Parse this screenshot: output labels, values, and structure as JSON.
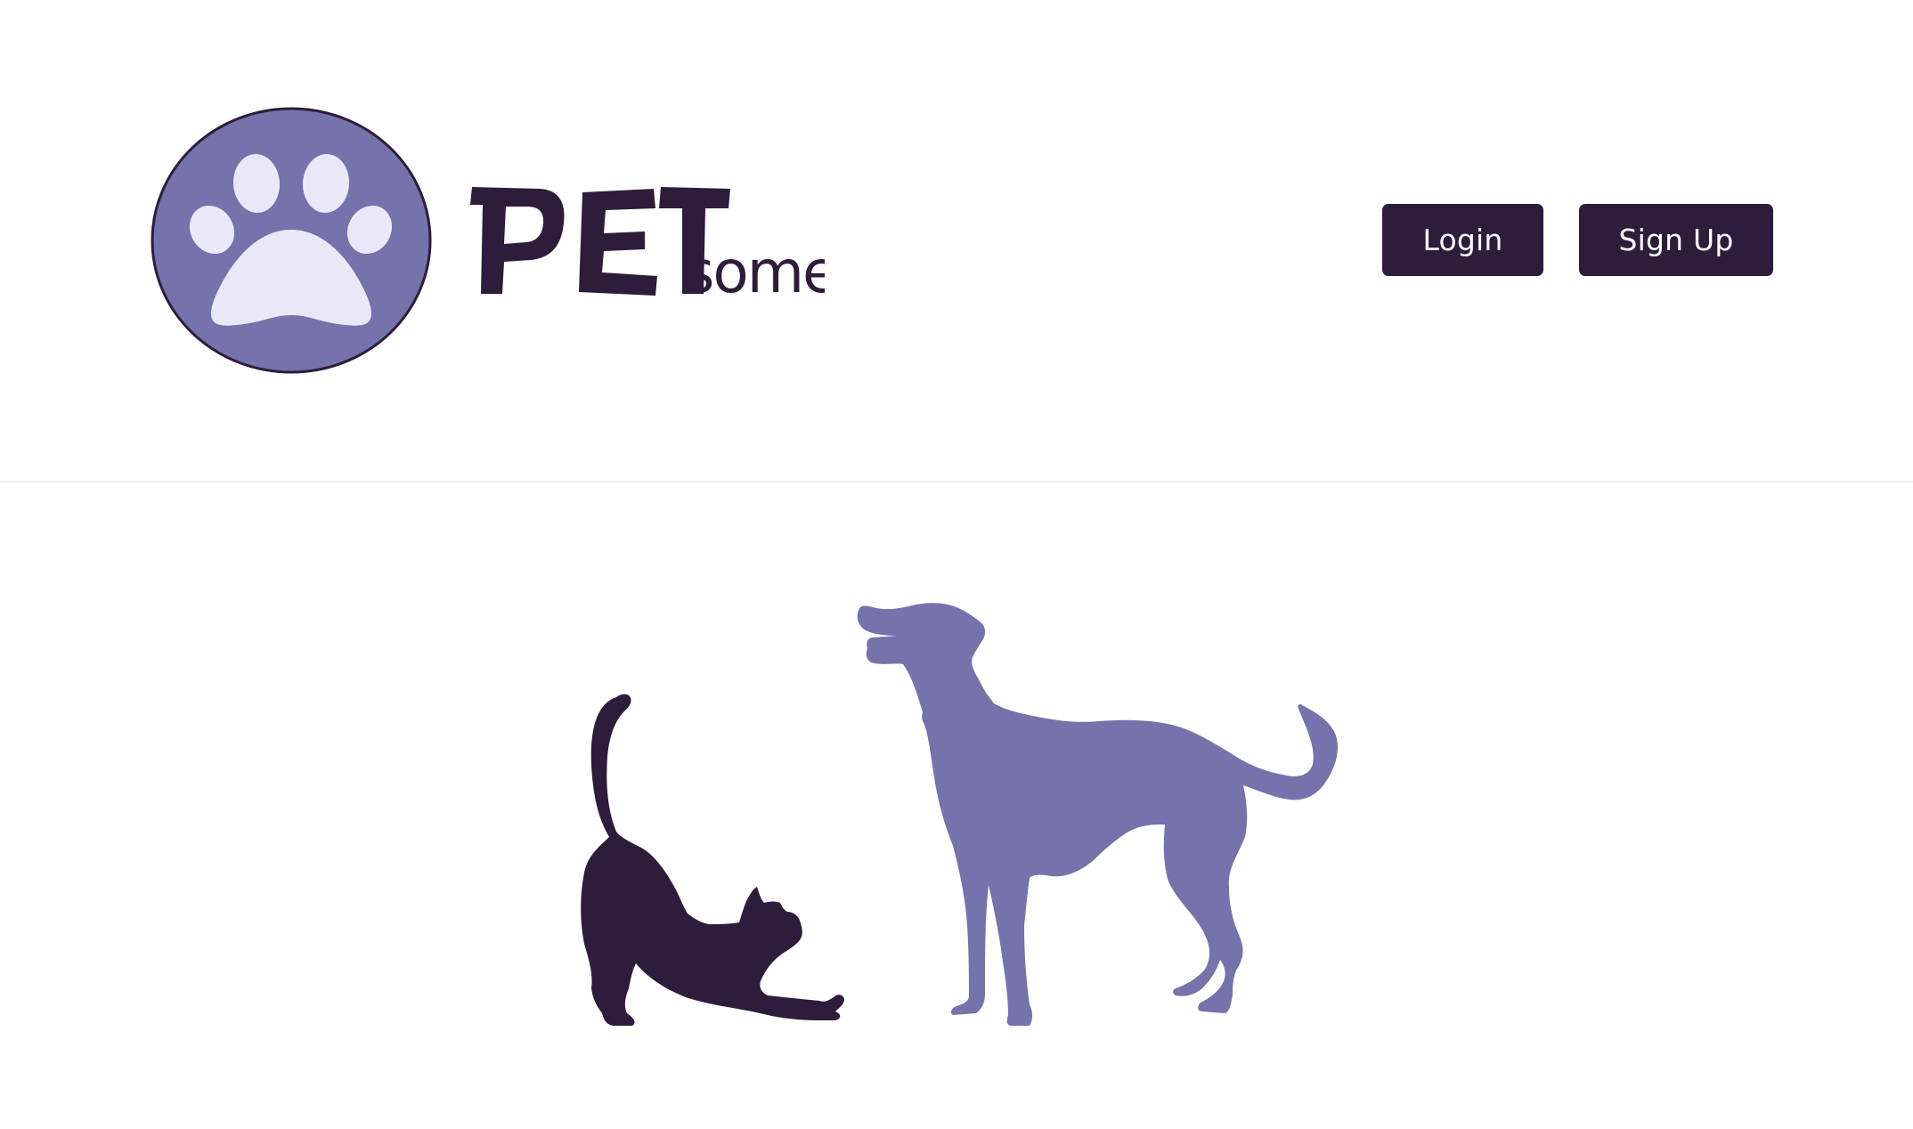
{
  "brand": {
    "name_main": "PET",
    "name_suffix": "some",
    "logo_icon": "paw-icon"
  },
  "nav": {
    "login_label": "Login",
    "signup_label": "Sign Up"
  },
  "hero": {
    "illustration": "cat-and-dog-silhouette"
  },
  "colors": {
    "brand_dark": "#2e1c3b",
    "brand_purple": "#7672ab",
    "paw_light": "#eae8f8"
  }
}
